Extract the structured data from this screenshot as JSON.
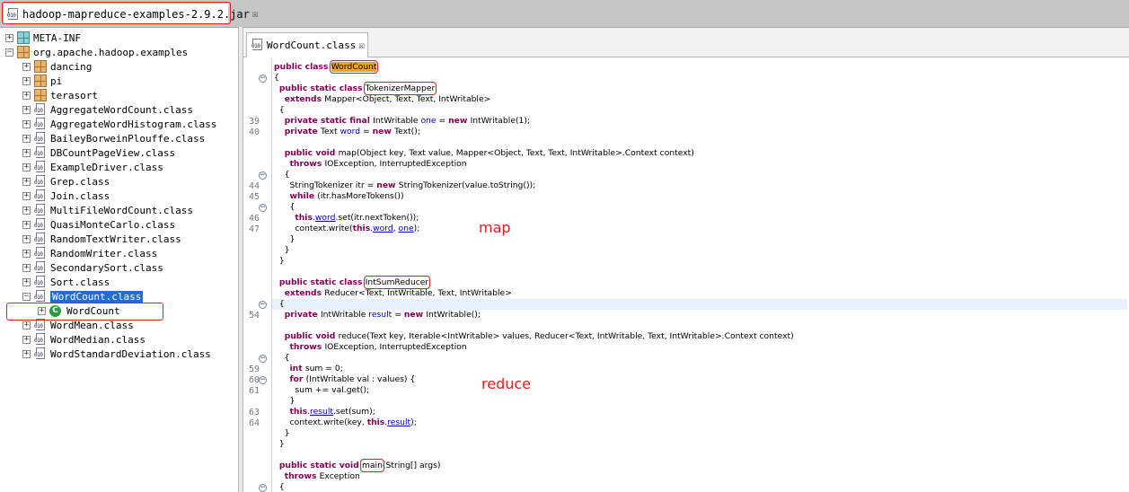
{
  "top_tab": {
    "icon": "jar-file-icon",
    "icon_text": "010",
    "label": "hadoop-mapreduce-examples-2.9.2.jar",
    "close": "☒"
  },
  "tree": {
    "items": [
      {
        "label": "META-INF",
        "icon": "meta-folder-icon",
        "expander": "+"
      },
      {
        "label": "org.apache.hadoop.examples",
        "icon": "package-icon",
        "expander": "−"
      },
      {
        "label": "dancing",
        "icon": "package-icon",
        "expander": "+"
      },
      {
        "label": "pi",
        "icon": "package-icon",
        "expander": "+"
      },
      {
        "label": "terasort",
        "icon": "package-icon",
        "expander": "+"
      },
      {
        "label": "AggregateWordCount.class",
        "icon": "class-file-icon",
        "expander": "+"
      },
      {
        "label": "AggregateWordHistogram.class",
        "icon": "class-file-icon",
        "expander": "+"
      },
      {
        "label": "BaileyBorweinPlouffe.class",
        "icon": "class-file-icon",
        "expander": "+"
      },
      {
        "label": "DBCountPageView.class",
        "icon": "class-file-icon",
        "expander": "+"
      },
      {
        "label": "ExampleDriver.class",
        "icon": "class-file-icon",
        "expander": "+"
      },
      {
        "label": "Grep.class",
        "icon": "class-file-icon",
        "expander": "+"
      },
      {
        "label": "Join.class",
        "icon": "class-file-icon",
        "expander": "+"
      },
      {
        "label": "MultiFileWordCount.class",
        "icon": "class-file-icon",
        "expander": "+"
      },
      {
        "label": "QuasiMonteCarlo.class",
        "icon": "class-file-icon",
        "expander": "+"
      },
      {
        "label": "RandomTextWriter.class",
        "icon": "class-file-icon",
        "expander": "+"
      },
      {
        "label": "RandomWriter.class",
        "icon": "class-file-icon",
        "expander": "+"
      },
      {
        "label": "SecondarySort.class",
        "icon": "class-file-icon",
        "expander": "+"
      },
      {
        "label": "Sort.class",
        "icon": "class-file-icon",
        "expander": "+"
      },
      {
        "label": "WordCount.class",
        "icon": "class-file-icon",
        "expander": "−",
        "selected": true
      },
      {
        "label": "WordCount",
        "icon": "class-type-icon",
        "expander": "+",
        "child": true
      },
      {
        "label": "WordMean.class",
        "icon": "class-file-icon",
        "expander": "+"
      },
      {
        "label": "WordMedian.class",
        "icon": "class-file-icon",
        "expander": "+"
      },
      {
        "label": "WordStandardDeviation.class",
        "icon": "class-file-icon",
        "expander": "+"
      }
    ],
    "class_icon_letter": "C",
    "file_icon_text": "010"
  },
  "editor": {
    "tab_label": "WordCount.class",
    "tab_close": "☒",
    "fold_symbol": "−",
    "lines": [
      {
        "num": "",
        "fold": false,
        "segs": [
          [
            "kw",
            "public class "
          ],
          [
            "hlbox",
            "WordCount"
          ]
        ]
      },
      {
        "num": "",
        "fold": true,
        "segs": [
          [
            "t",
            "{"
          ]
        ]
      },
      {
        "num": "",
        "fold": false,
        "segs": [
          [
            "t",
            "  "
          ],
          [
            "kw",
            "public static class "
          ],
          [
            "box",
            "TokenizerMapper"
          ]
        ]
      },
      {
        "num": "",
        "fold": false,
        "segs": [
          [
            "t",
            "    "
          ],
          [
            "kw",
            "extends "
          ],
          [
            "t",
            "Mapper<Object, Text, Text, IntWritable>"
          ]
        ]
      },
      {
        "num": "",
        "fold": false,
        "segs": [
          [
            "t",
            "  {"
          ]
        ]
      },
      {
        "num": "39",
        "fold": false,
        "segs": [
          [
            "t",
            "    "
          ],
          [
            "kw",
            "private static final "
          ],
          [
            "t",
            "IntWritable "
          ],
          [
            "fld",
            "one"
          ],
          [
            "t",
            " = "
          ],
          [
            "kw",
            "new "
          ],
          [
            "t",
            "IntWritable(1);"
          ]
        ]
      },
      {
        "num": "40",
        "fold": false,
        "segs": [
          [
            "t",
            "    "
          ],
          [
            "kw",
            "private "
          ],
          [
            "t",
            "Text "
          ],
          [
            "fld",
            "word"
          ],
          [
            "t",
            " = "
          ],
          [
            "kw",
            "new "
          ],
          [
            "t",
            "Text();"
          ]
        ]
      },
      {
        "num": "",
        "fold": false,
        "segs": []
      },
      {
        "num": "",
        "fold": false,
        "segs": [
          [
            "t",
            "    "
          ],
          [
            "kw",
            "public void "
          ],
          [
            "t",
            "map(Object key, Text value, Mapper<Object, Text, Text, IntWritable>.Context context)"
          ]
        ]
      },
      {
        "num": "",
        "fold": false,
        "segs": [
          [
            "t",
            "      "
          ],
          [
            "kw",
            "throws "
          ],
          [
            "t",
            "IOException, InterruptedException"
          ]
        ]
      },
      {
        "num": "",
        "fold": true,
        "segs": [
          [
            "t",
            "    {"
          ]
        ]
      },
      {
        "num": "44",
        "fold": false,
        "segs": [
          [
            "t",
            "      StringTokenizer itr = "
          ],
          [
            "kw",
            "new "
          ],
          [
            "t",
            "StringTokenizer(value.toString());"
          ]
        ]
      },
      {
        "num": "45",
        "fold": false,
        "segs": [
          [
            "t",
            "      "
          ],
          [
            "kw",
            "while "
          ],
          [
            "t",
            "(itr.hasMoreTokens())"
          ]
        ]
      },
      {
        "num": "",
        "fold": true,
        "segs": [
          [
            "t",
            "      {"
          ]
        ]
      },
      {
        "num": "46",
        "fold": false,
        "segs": [
          [
            "t",
            "        "
          ],
          [
            "kw",
            "this"
          ],
          [
            "t",
            "."
          ],
          [
            "fldu",
            "word"
          ],
          [
            "t",
            ".set(itr.nextToken());"
          ]
        ]
      },
      {
        "num": "47",
        "fold": false,
        "segs": [
          [
            "t",
            "        context.write("
          ],
          [
            "kw",
            "this"
          ],
          [
            "t",
            "."
          ],
          [
            "fldu",
            "word"
          ],
          [
            "t",
            ", "
          ],
          [
            "fldu",
            "one"
          ],
          [
            "t",
            ");"
          ]
        ]
      },
      {
        "num": "",
        "fold": false,
        "segs": [
          [
            "t",
            "      }"
          ]
        ]
      },
      {
        "num": "",
        "fold": false,
        "segs": [
          [
            "t",
            "    }"
          ]
        ]
      },
      {
        "num": "",
        "fold": false,
        "segs": [
          [
            "t",
            "  }"
          ]
        ]
      },
      {
        "num": "",
        "fold": false,
        "segs": []
      },
      {
        "num": "",
        "fold": false,
        "segs": [
          [
            "t",
            "  "
          ],
          [
            "kw",
            "public static class "
          ],
          [
            "box",
            "IntSumReducer"
          ]
        ]
      },
      {
        "num": "",
        "fold": false,
        "segs": [
          [
            "t",
            "    "
          ],
          [
            "kw",
            "extends "
          ],
          [
            "t",
            "Reducer<Text, IntWritable, Text, IntWritable>"
          ]
        ]
      },
      {
        "num": "",
        "fold": true,
        "current": true,
        "segs": [
          [
            "t",
            "  {"
          ]
        ]
      },
      {
        "num": "54",
        "fold": false,
        "segs": [
          [
            "t",
            "    "
          ],
          [
            "kw",
            "private "
          ],
          [
            "t",
            "IntWritable "
          ],
          [
            "fld",
            "result"
          ],
          [
            "t",
            " = "
          ],
          [
            "kw",
            "new "
          ],
          [
            "t",
            "IntWritable();"
          ]
        ]
      },
      {
        "num": "",
        "fold": false,
        "segs": []
      },
      {
        "num": "",
        "fold": false,
        "segs": [
          [
            "t",
            "    "
          ],
          [
            "kw",
            "public void "
          ],
          [
            "t",
            "reduce(Text key, Iterable<IntWritable> values, Reducer<Text, IntWritable, Text, IntWritable>.Context context)"
          ]
        ]
      },
      {
        "num": "",
        "fold": false,
        "segs": [
          [
            "t",
            "      "
          ],
          [
            "kw",
            "throws "
          ],
          [
            "t",
            "IOException, InterruptedException"
          ]
        ]
      },
      {
        "num": "",
        "fold": true,
        "segs": [
          [
            "t",
            "    {"
          ]
        ]
      },
      {
        "num": "59",
        "fold": false,
        "segs": [
          [
            "t",
            "      "
          ],
          [
            "kw",
            "int "
          ],
          [
            "t",
            "sum = 0;"
          ]
        ]
      },
      {
        "num": "60",
        "fold": true,
        "segs": [
          [
            "t",
            "      "
          ],
          [
            "kw",
            "for "
          ],
          [
            "t",
            "(IntWritable val : values) {"
          ]
        ]
      },
      {
        "num": "61",
        "fold": false,
        "segs": [
          [
            "t",
            "        sum += val.get();"
          ]
        ]
      },
      {
        "num": "",
        "fold": false,
        "segs": [
          [
            "t",
            "      }"
          ]
        ]
      },
      {
        "num": "63",
        "fold": false,
        "segs": [
          [
            "t",
            "      "
          ],
          [
            "kw",
            "this"
          ],
          [
            "t",
            "."
          ],
          [
            "fldu",
            "result"
          ],
          [
            "t",
            ".set(sum);"
          ]
        ]
      },
      {
        "num": "64",
        "fold": false,
        "segs": [
          [
            "t",
            "      context.write(key, "
          ],
          [
            "kw",
            "this"
          ],
          [
            "t",
            "."
          ],
          [
            "fldu",
            "result"
          ],
          [
            "t",
            ");"
          ]
        ]
      },
      {
        "num": "",
        "fold": false,
        "segs": [
          [
            "t",
            "    }"
          ]
        ]
      },
      {
        "num": "",
        "fold": false,
        "segs": [
          [
            "t",
            "  }"
          ]
        ]
      },
      {
        "num": "",
        "fold": false,
        "segs": []
      },
      {
        "num": "",
        "fold": false,
        "segs": [
          [
            "t",
            "  "
          ],
          [
            "kw",
            "public static void "
          ],
          [
            "box",
            "main"
          ],
          [
            "t",
            "(String[] args)"
          ]
        ]
      },
      {
        "num": "",
        "fold": false,
        "segs": [
          [
            "t",
            "    "
          ],
          [
            "kw",
            "throws "
          ],
          [
            "t",
            "Exception"
          ]
        ]
      },
      {
        "num": "",
        "fold": true,
        "segs": [
          [
            "t",
            "  {"
          ]
        ]
      }
    ]
  },
  "annotations": {
    "map": "map",
    "reduce": "reduce"
  }
}
